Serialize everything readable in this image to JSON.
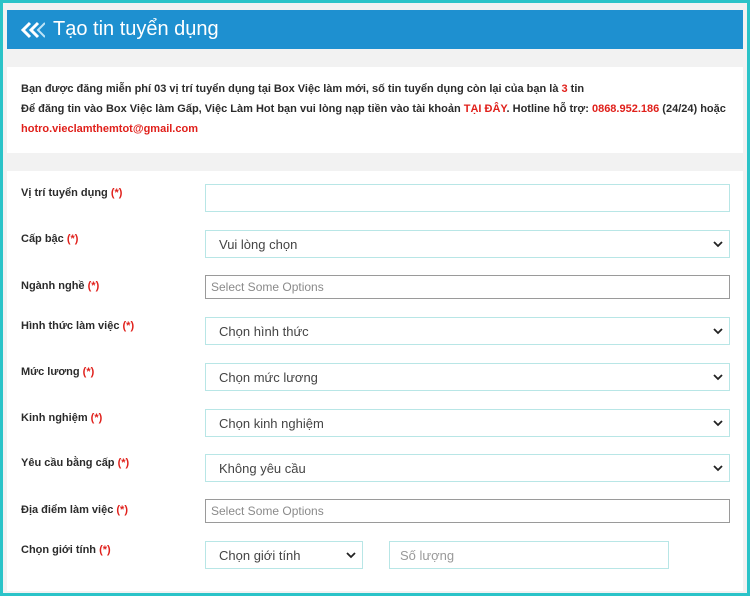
{
  "header": {
    "title": "Tạo tin tuyển dụng",
    "icon": "double-chevron-left-icon"
  },
  "info": {
    "line1_a": "Bạn được đăng miễn phí 03 vị trí tuyển dụng tại Box Việc làm mới, số tin tuyển dụng còn lại của bạn là ",
    "line1_count": "3",
    "line1_b": " tin",
    "line2_a": "Để đăng tin vào Box Việc làm Gấp, Việc Làm Hot bạn vui lòng nạp tiền vào tài khoản ",
    "line2_link": "TẠI ĐÂY",
    "line2_b": ". Hotline hỗ trợ: ",
    "hotline": "0868.952.186",
    "line2_c": " (24/24) hoặc",
    "email": "hotro.vieclamthemtot@gmail.com"
  },
  "form": {
    "required_mark": "(*)",
    "position": {
      "label": "Vị trí tuyển dụng",
      "value": ""
    },
    "level": {
      "label": "Cấp bậc",
      "value": "Vui lòng chọn"
    },
    "industry": {
      "label": "Ngành nghề",
      "placeholder": "Select Some Options"
    },
    "work_type": {
      "label": "Hình thức làm việc",
      "value": "Chọn hình thức"
    },
    "salary": {
      "label": "Mức lương",
      "value": "Chọn mức lương"
    },
    "experience": {
      "label": "Kinh nghiệm",
      "value": "Chọn kinh nghiệm"
    },
    "degree": {
      "label": "Yêu cầu bằng cấp",
      "value": "Không yêu cầu"
    },
    "location": {
      "label": "Địa điểm làm việc",
      "placeholder": "Select Some Options"
    },
    "gender": {
      "label": "Chọn giới tính",
      "value": "Chọn giới tính",
      "quantity_placeholder": "Số lượng"
    }
  },
  "colors": {
    "header_bg": "#1e90d0",
    "frame_border": "#2bc3c8",
    "accent_red": "#e0201b"
  }
}
